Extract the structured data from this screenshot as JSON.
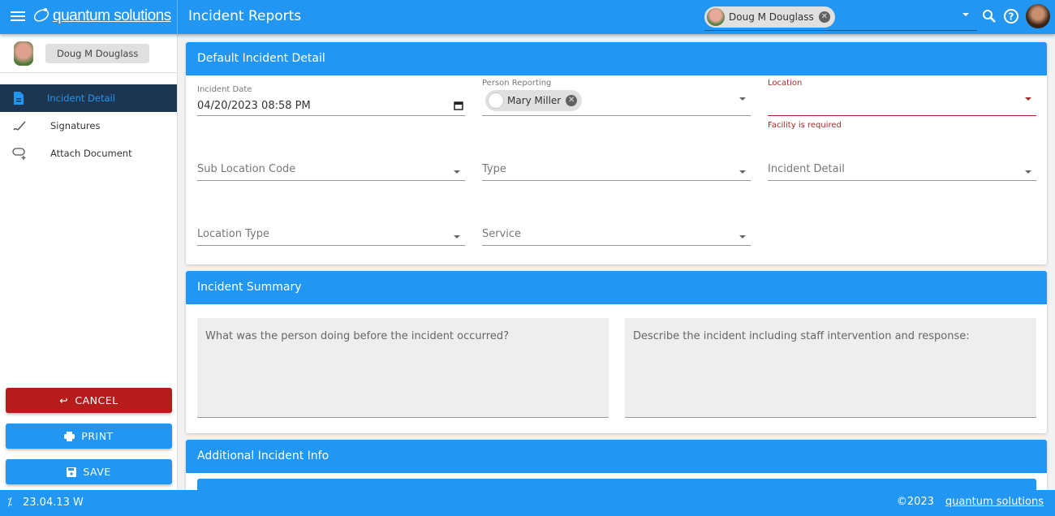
{
  "header": {
    "logo_text": "quantum solutions",
    "title": "Incident Reports",
    "selected_client": "Doug M Douglass"
  },
  "sidebar": {
    "user": "Doug M Douglass",
    "items": [
      {
        "label": "Incident Detail",
        "icon": "document-icon",
        "active": true
      },
      {
        "label": "Signatures",
        "icon": "signature-icon"
      },
      {
        "label": "Attach Document",
        "icon": "attach-icon"
      }
    ],
    "buttons": {
      "cancel": "CANCEL",
      "print": "PRINT",
      "save": "SAVE"
    }
  },
  "colors": {
    "primary": "#2196f3",
    "cancel": "#b71c1c",
    "error": "#a52a2a",
    "nav_active": "#1c3550"
  },
  "detail": {
    "title": "Default Incident Detail",
    "incident_date_label": "Incident Date",
    "incident_date": "04/20/2023 08:58 PM",
    "person_reporting_label": "Person Reporting",
    "person_reporting": "Mary Miller",
    "location_label": "Location",
    "location_error": "Facility is required",
    "sub_location": "Sub Location Code",
    "type": "Type",
    "incident_detail": "Incident Detail",
    "location_type": "Location Type",
    "service": "Service"
  },
  "summary": {
    "title": "Incident Summary",
    "before_placeholder": "What was the person doing before the incident occurred?",
    "describe_placeholder": "Describe the incident including staff intervention and response:"
  },
  "additional": {
    "title": "Additional Incident Info"
  },
  "footer": {
    "version": "23.04.13 W",
    "copyright": "©2023",
    "logo_text": "quantum solutions"
  }
}
